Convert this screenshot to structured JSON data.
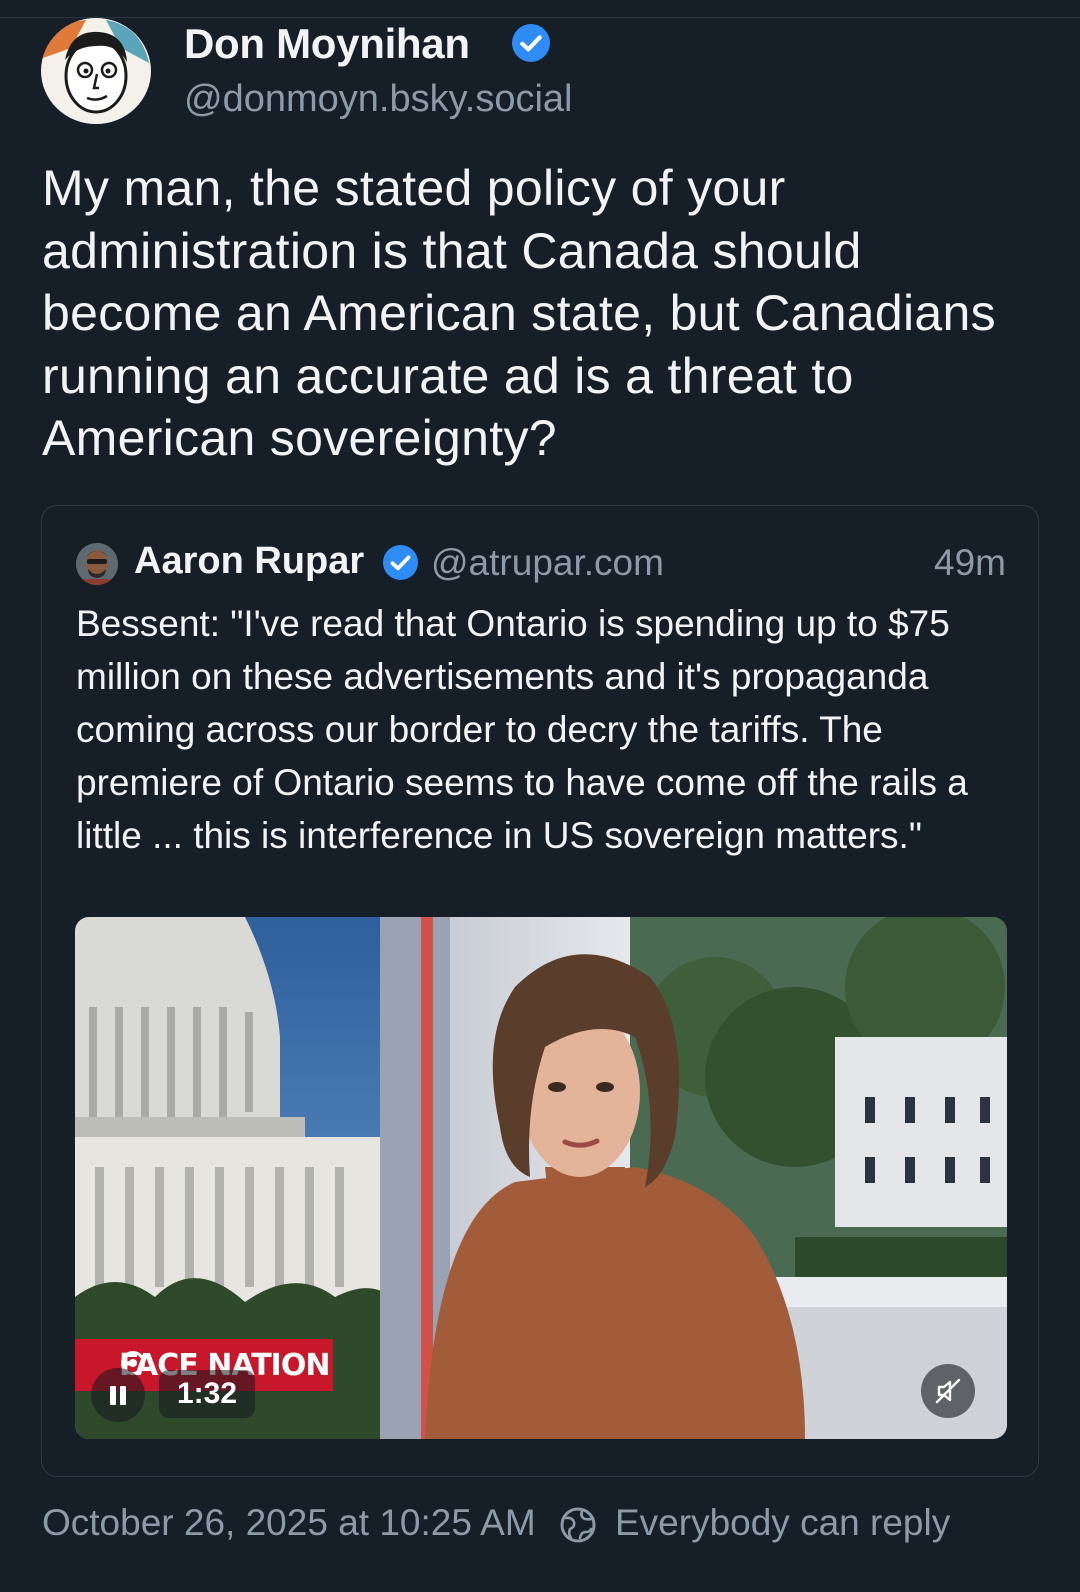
{
  "post": {
    "author": {
      "display_name": "Don Moynihan",
      "handle": "@donmoyn.bsky.social",
      "verified": true
    },
    "text": "My man, the stated policy of your administration is that Canada should become an American state, but Canadians running an accurate ad is a threat to American sovereignty?",
    "quote": {
      "author": {
        "display_name": "Aaron Rupar",
        "handle": "@atrupar.com",
        "verified": true
      },
      "time_ago": "49m",
      "text": "Bessent: \"I've read that Ontario is spending up to $75 million on these advertisements and it's propaganda coming across our border to decry the tariffs. The premiere of Ontario seems to have come off the rails a little ... this is interference in US sovereign matters.\"",
      "video": {
        "logo_text": "FACE NATION",
        "duration": "1:32",
        "playing": true,
        "muted": true
      }
    },
    "timestamp": "October 26, 2025 at 10:25 AM",
    "reply_setting": "Everybody can reply"
  },
  "colors": {
    "background": "#161e27",
    "text_primary": "#f1f3f5",
    "text_secondary": "#8d9aa8",
    "verified_blue": "#2f8cf4",
    "card_border": "#2f3a46",
    "cbs_red": "#c8172a"
  }
}
